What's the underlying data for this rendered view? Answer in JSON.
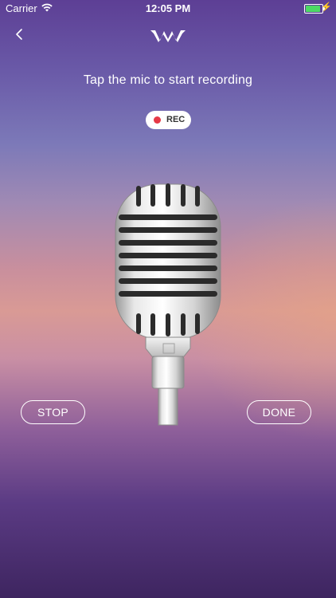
{
  "status_bar": {
    "carrier": "Carrier",
    "time": "12:05 PM",
    "battery_color": "#4cd964"
  },
  "nav": {
    "back_icon": "chevron-left-icon",
    "logo_icon": "waveform-logo-icon"
  },
  "main": {
    "instruction": "Tap the mic to start recording",
    "rec_badge": "REC",
    "rec_dot_color": "#e63946",
    "mic_icon": "vintage-microphone"
  },
  "controls": {
    "stop_label": "STOP",
    "done_label": "DONE"
  }
}
